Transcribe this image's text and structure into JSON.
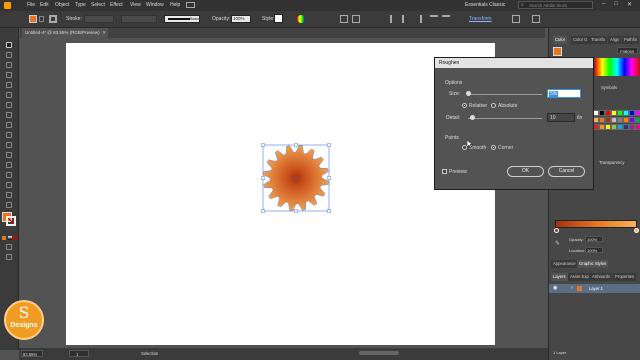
{
  "app": {
    "menu": [
      "File",
      "Edit",
      "Object",
      "Type",
      "Select",
      "Effect",
      "View",
      "Window",
      "Help"
    ],
    "workspace": "Essentials Classic",
    "search_placeholder": "Search Adobe Stock"
  },
  "control_bar": {
    "stroke_label": "Stroke:",
    "basic_label": "Basic",
    "opacity_label": "Opacity:",
    "opacity_value": "100%",
    "style_label": "Style:",
    "transform_label": "Transform"
  },
  "document": {
    "tab_title": "Untitled-4* @ 83.55% (RGB/Preview)"
  },
  "status": {
    "zoom": "83.55%",
    "page": "1",
    "tool": "Selection"
  },
  "dialog": {
    "title": "Roughen",
    "options_heading": "Options",
    "size_label": "Size:",
    "size_value": "5%",
    "relative_label": "Relative",
    "absolute_label": "Absolute",
    "detail_label": "Detail:",
    "detail_value": "10",
    "detail_unit": "/in",
    "points_heading": "Points",
    "smooth_label": "Smooth",
    "corner_label": "Corner",
    "preview_label": "Preview",
    "ok_label": "OK",
    "cancel_label": "Cancel"
  },
  "right_panel": {
    "color_tabs": [
      "Color",
      "Color G",
      "Transfo",
      "Align",
      "Pathfin"
    ],
    "hex_value": "F9B059",
    "symbols_label": "Symbols",
    "transparency_label": "Transparency",
    "opacity_label": "Opacity:",
    "opacity_value": "100%",
    "location_label": "Location:",
    "location_value": "100%",
    "appearance_tab": "Appearance",
    "graphic_styles_tab": "Graphic Styles",
    "layer_tabs": [
      "Layers",
      "Asset Exp",
      "Artboards",
      "Properties"
    ],
    "layer_name": "Layer 1",
    "layer_count": "1 Layer"
  },
  "watermark": {
    "letter": "S",
    "text": "Designs"
  },
  "colors": {
    "accent": "#3d8ee0",
    "shape_outer": "#e37726",
    "shape_inner": "#a1320f",
    "logo": "#f29b22"
  }
}
